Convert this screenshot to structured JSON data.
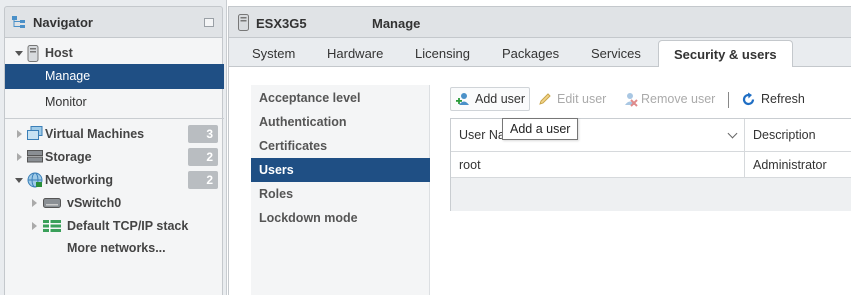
{
  "navigator": {
    "title": "Navigator",
    "host_label": "Host",
    "manage_label": "Manage",
    "monitor_label": "Monitor",
    "items": [
      {
        "label": "Virtual Machines",
        "count": "3",
        "icon": "virtual-machines-icon"
      },
      {
        "label": "Storage",
        "count": "2",
        "icon": "storage-icon"
      },
      {
        "label": "Networking",
        "count": "2",
        "icon": "networking-icon"
      }
    ],
    "network_children": [
      {
        "label": "vSwitch0",
        "icon": "vswitch-icon"
      },
      {
        "label": "Default TCP/IP stack",
        "icon": "tcpip-stack-icon"
      },
      {
        "label": "More networks..."
      }
    ]
  },
  "header": {
    "host_name": "ESX3G5",
    "page_name": "Manage"
  },
  "tabs": [
    "System",
    "Hardware",
    "Licensing",
    "Packages",
    "Services",
    "Security & users"
  ],
  "active_tab": "Security & users",
  "subnav": [
    "Acceptance level",
    "Authentication",
    "Certificates",
    "Users",
    "Roles",
    "Lockdown mode"
  ],
  "active_subnav": "Users",
  "toolbar": {
    "add_user": "Add user",
    "edit_user": "Edit user",
    "remove_user": "Remove user",
    "refresh": "Refresh"
  },
  "tooltip": "Add a user",
  "table": {
    "columns": [
      "User Na",
      "Description"
    ],
    "rows": [
      {
        "user": "root",
        "description": "Administrator"
      }
    ]
  },
  "colors": {
    "selected": "#1f4f84",
    "badge": "#b9bdc1",
    "refresh_icon": "#1f6ec4"
  }
}
